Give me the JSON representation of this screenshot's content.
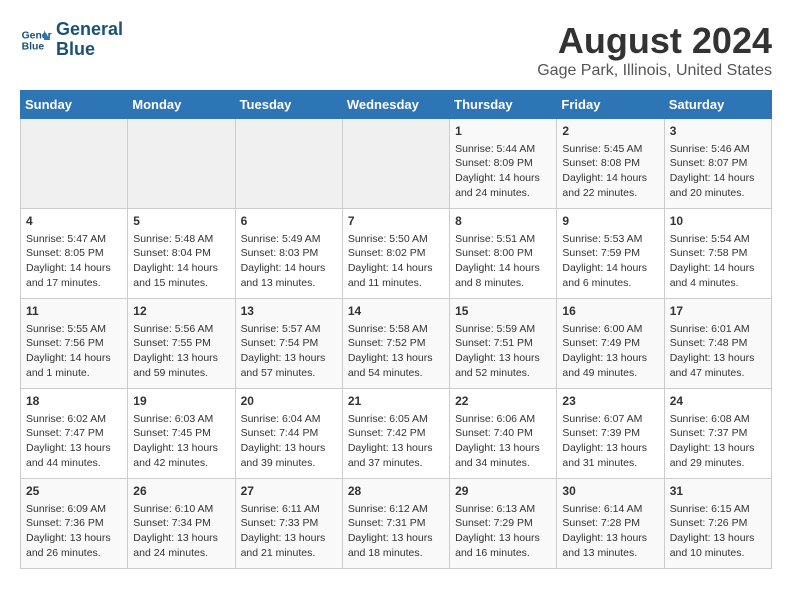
{
  "header": {
    "logo_line1": "General",
    "logo_line2": "Blue",
    "month": "August 2024",
    "location": "Gage Park, Illinois, United States"
  },
  "weekdays": [
    "Sunday",
    "Monday",
    "Tuesday",
    "Wednesday",
    "Thursday",
    "Friday",
    "Saturday"
  ],
  "weeks": [
    [
      {
        "day": "",
        "content": ""
      },
      {
        "day": "",
        "content": ""
      },
      {
        "day": "",
        "content": ""
      },
      {
        "day": "",
        "content": ""
      },
      {
        "day": "1",
        "content": "Sunrise: 5:44 AM\nSunset: 8:09 PM\nDaylight: 14 hours and 24 minutes."
      },
      {
        "day": "2",
        "content": "Sunrise: 5:45 AM\nSunset: 8:08 PM\nDaylight: 14 hours and 22 minutes."
      },
      {
        "day": "3",
        "content": "Sunrise: 5:46 AM\nSunset: 8:07 PM\nDaylight: 14 hours and 20 minutes."
      }
    ],
    [
      {
        "day": "4",
        "content": "Sunrise: 5:47 AM\nSunset: 8:05 PM\nDaylight: 14 hours and 17 minutes."
      },
      {
        "day": "5",
        "content": "Sunrise: 5:48 AM\nSunset: 8:04 PM\nDaylight: 14 hours and 15 minutes."
      },
      {
        "day": "6",
        "content": "Sunrise: 5:49 AM\nSunset: 8:03 PM\nDaylight: 14 hours and 13 minutes."
      },
      {
        "day": "7",
        "content": "Sunrise: 5:50 AM\nSunset: 8:02 PM\nDaylight: 14 hours and 11 minutes."
      },
      {
        "day": "8",
        "content": "Sunrise: 5:51 AM\nSunset: 8:00 PM\nDaylight: 14 hours and 8 minutes."
      },
      {
        "day": "9",
        "content": "Sunrise: 5:53 AM\nSunset: 7:59 PM\nDaylight: 14 hours and 6 minutes."
      },
      {
        "day": "10",
        "content": "Sunrise: 5:54 AM\nSunset: 7:58 PM\nDaylight: 14 hours and 4 minutes."
      }
    ],
    [
      {
        "day": "11",
        "content": "Sunrise: 5:55 AM\nSunset: 7:56 PM\nDaylight: 14 hours and 1 minute."
      },
      {
        "day": "12",
        "content": "Sunrise: 5:56 AM\nSunset: 7:55 PM\nDaylight: 13 hours and 59 minutes."
      },
      {
        "day": "13",
        "content": "Sunrise: 5:57 AM\nSunset: 7:54 PM\nDaylight: 13 hours and 57 minutes."
      },
      {
        "day": "14",
        "content": "Sunrise: 5:58 AM\nSunset: 7:52 PM\nDaylight: 13 hours and 54 minutes."
      },
      {
        "day": "15",
        "content": "Sunrise: 5:59 AM\nSunset: 7:51 PM\nDaylight: 13 hours and 52 minutes."
      },
      {
        "day": "16",
        "content": "Sunrise: 6:00 AM\nSunset: 7:49 PM\nDaylight: 13 hours and 49 minutes."
      },
      {
        "day": "17",
        "content": "Sunrise: 6:01 AM\nSunset: 7:48 PM\nDaylight: 13 hours and 47 minutes."
      }
    ],
    [
      {
        "day": "18",
        "content": "Sunrise: 6:02 AM\nSunset: 7:47 PM\nDaylight: 13 hours and 44 minutes."
      },
      {
        "day": "19",
        "content": "Sunrise: 6:03 AM\nSunset: 7:45 PM\nDaylight: 13 hours and 42 minutes."
      },
      {
        "day": "20",
        "content": "Sunrise: 6:04 AM\nSunset: 7:44 PM\nDaylight: 13 hours and 39 minutes."
      },
      {
        "day": "21",
        "content": "Sunrise: 6:05 AM\nSunset: 7:42 PM\nDaylight: 13 hours and 37 minutes."
      },
      {
        "day": "22",
        "content": "Sunrise: 6:06 AM\nSunset: 7:40 PM\nDaylight: 13 hours and 34 minutes."
      },
      {
        "day": "23",
        "content": "Sunrise: 6:07 AM\nSunset: 7:39 PM\nDaylight: 13 hours and 31 minutes."
      },
      {
        "day": "24",
        "content": "Sunrise: 6:08 AM\nSunset: 7:37 PM\nDaylight: 13 hours and 29 minutes."
      }
    ],
    [
      {
        "day": "25",
        "content": "Sunrise: 6:09 AM\nSunset: 7:36 PM\nDaylight: 13 hours and 26 minutes."
      },
      {
        "day": "26",
        "content": "Sunrise: 6:10 AM\nSunset: 7:34 PM\nDaylight: 13 hours and 24 minutes."
      },
      {
        "day": "27",
        "content": "Sunrise: 6:11 AM\nSunset: 7:33 PM\nDaylight: 13 hours and 21 minutes."
      },
      {
        "day": "28",
        "content": "Sunrise: 6:12 AM\nSunset: 7:31 PM\nDaylight: 13 hours and 18 minutes."
      },
      {
        "day": "29",
        "content": "Sunrise: 6:13 AM\nSunset: 7:29 PM\nDaylight: 13 hours and 16 minutes."
      },
      {
        "day": "30",
        "content": "Sunrise: 6:14 AM\nSunset: 7:28 PM\nDaylight: 13 hours and 13 minutes."
      },
      {
        "day": "31",
        "content": "Sunrise: 6:15 AM\nSunset: 7:26 PM\nDaylight: 13 hours and 10 minutes."
      }
    ]
  ]
}
